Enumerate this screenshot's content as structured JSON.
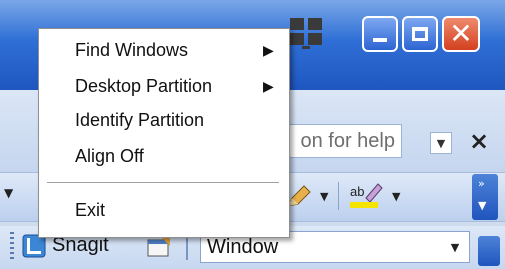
{
  "menu": {
    "items": [
      {
        "label": "Find Windows",
        "has_submenu": true
      },
      {
        "label": "Desktop Partition",
        "has_submenu": true
      },
      {
        "label": "Identify Partition",
        "has_submenu": false
      },
      {
        "label": "Align Off",
        "has_submenu": false
      },
      {
        "label": "Exit",
        "has_submenu": false
      }
    ],
    "submenu_arrow": "▶"
  },
  "window": {
    "close_glyph": "✕",
    "icons": [
      "minimize-icon",
      "maximize-icon",
      "close-icon",
      "partition-tray-icon"
    ]
  },
  "help": {
    "text": "on for help",
    "dropdown_glyph": "▼",
    "close_glyph": "×"
  },
  "toolbar": {
    "dropdown_glyph": "▼",
    "overflow_glyph": "»",
    "icons": [
      "pen-icon",
      "highlight-ab-icon"
    ]
  },
  "snagit": {
    "label": "Snagit",
    "profile_value": "Window",
    "dropdown_glyph": "▼",
    "icons": [
      "snagit-icon",
      "capture-icon"
    ]
  },
  "colors": {
    "titlebar": "#2f6fd6",
    "close_button": "#d2401e",
    "menu_background": "#ffffff"
  }
}
